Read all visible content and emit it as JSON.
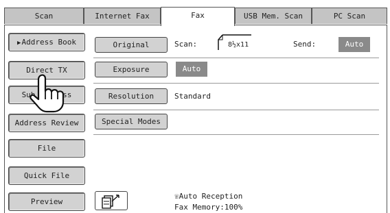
{
  "tabs": [
    {
      "label": "Scan"
    },
    {
      "label": "Internet Fax"
    },
    {
      "label": "Fax"
    },
    {
      "label": "USB Mem. Scan"
    },
    {
      "label": "PC Scan"
    }
  ],
  "left_buttons": {
    "address_book": "Address Book",
    "direct_tx": "Direct TX",
    "sub_address": "Sub Address",
    "address_review": "Address Review",
    "file": "File",
    "quick_file": "Quick File",
    "preview": "Preview"
  },
  "settings": {
    "original_label": "Original",
    "scan_label": "Scan:",
    "paper_size": "8½x11",
    "send_label": "Send:",
    "send_value": "Auto",
    "exposure_label": "Exposure",
    "exposure_value": "Auto",
    "resolution_label": "Resolution",
    "resolution_value": "Standard",
    "special_modes_label": "Special Modes"
  },
  "status": {
    "reception": "Auto Reception",
    "memory": "Fax Memory:100%"
  },
  "icons": [
    "arrow-right-icon",
    "paper-icon",
    "hand-pointer-icon",
    "phone-icon",
    "document-edit-icon"
  ]
}
